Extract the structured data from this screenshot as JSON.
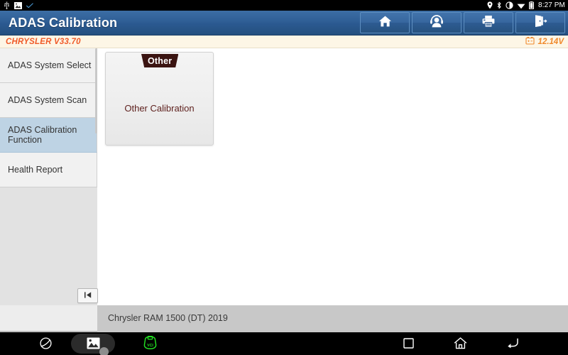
{
  "statusbar": {
    "left_icons": [
      "usb-icon",
      "screenshot-icon",
      "check-icon"
    ],
    "right_icons": [
      "location-icon",
      "bluetooth-icon",
      "brightness-icon",
      "wifi-icon",
      "battery-icon"
    ],
    "time": "8:27 PM"
  },
  "header": {
    "title": "ADAS Calibration",
    "buttons": [
      {
        "name": "home-button",
        "icon": "home-icon"
      },
      {
        "name": "support-button",
        "icon": "headset-person-icon"
      },
      {
        "name": "print-button",
        "icon": "printer-icon"
      },
      {
        "name": "exit-button",
        "icon": "exit-door-icon"
      }
    ]
  },
  "versionbar": {
    "version": "CHRYSLER V33.70",
    "voltage": "12.14V",
    "voltage_icon": "battery-voltage-icon",
    "version_color": "#f05a28",
    "voltage_color": "#f0892c"
  },
  "sidebar": {
    "items": [
      {
        "label": "ADAS System Select",
        "active": false
      },
      {
        "label": "ADAS System Scan",
        "active": false
      },
      {
        "label": "ADAS Calibration Function",
        "active": true
      },
      {
        "label": "Health Report",
        "active": false
      }
    ],
    "active_color": "#bed3e4"
  },
  "main": {
    "cards": [
      {
        "ribbon": "Other",
        "label": "Other Calibration",
        "ribbon_color": "#3b1411",
        "label_color": "#5d1f1c"
      }
    ]
  },
  "collapse_button": {
    "glyph": "I◀",
    "name": "collapse-sidebar-button"
  },
  "footer": {
    "vehicle": "Chrysler RAM 1500 (DT) 2019"
  },
  "navbar": {
    "items": [
      {
        "name": "nav-planet-icon"
      },
      {
        "name": "nav-screenshot-icon"
      },
      {
        "name": "nav-vci-icon"
      },
      {
        "name": "nav-recents-icon"
      },
      {
        "name": "nav-home-icon"
      },
      {
        "name": "nav-back-icon"
      }
    ],
    "vci_color": "#22dd22"
  }
}
